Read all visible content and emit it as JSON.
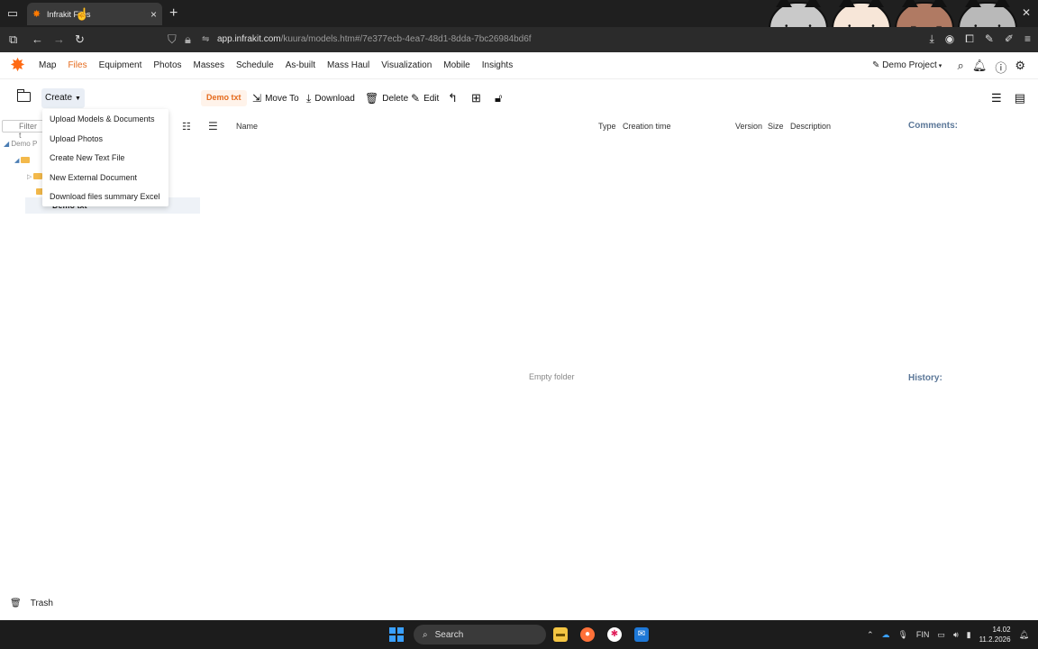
{
  "browser": {
    "tab_title": "Infrakit Files",
    "new_tab_icon": "plus-icon",
    "url_host": "app.infrakit.com",
    "url_path": "/kuura/models.htm#/7e377ecb-4ea7-48d1-8dda-7bc26984bd6f"
  },
  "app": {
    "menu": [
      "Map",
      "Files",
      "Equipment",
      "Photos",
      "Masses",
      "Schedule",
      "As-built",
      "Mass Haul",
      "Visualization",
      "Mobile",
      "Insights"
    ],
    "active_menu": "Files",
    "project": "Demo Project",
    "accent_color": "#e56a1c"
  },
  "toolbar": {
    "create_label": "Create",
    "breadcrumb_chip": "Demo txt",
    "move_to": "Move To",
    "download": "Download",
    "delete": "Delete",
    "edit": "Edit"
  },
  "dropdown": {
    "items": [
      "Upload Models & Documents",
      "Upload Photos",
      "Create New Text File",
      "New External Document",
      "Download files summary Excel"
    ]
  },
  "left_panel": {
    "filter_placeholder": "Filter t",
    "tree_root": "Demo P",
    "selected_folder": "Demo txt",
    "trash_label": "Trash"
  },
  "table": {
    "headers": {
      "name": "Name",
      "type": "Type",
      "creation_time": "Creation time",
      "version": "Version",
      "size": "Size",
      "description": "Description"
    },
    "empty_text": "Empty folder"
  },
  "side": {
    "comments": "Comments:",
    "history": "History:"
  },
  "taskbar": {
    "search_label": "Search",
    "lang": "FIN",
    "time": "14.02",
    "date": "11.2.2026"
  }
}
